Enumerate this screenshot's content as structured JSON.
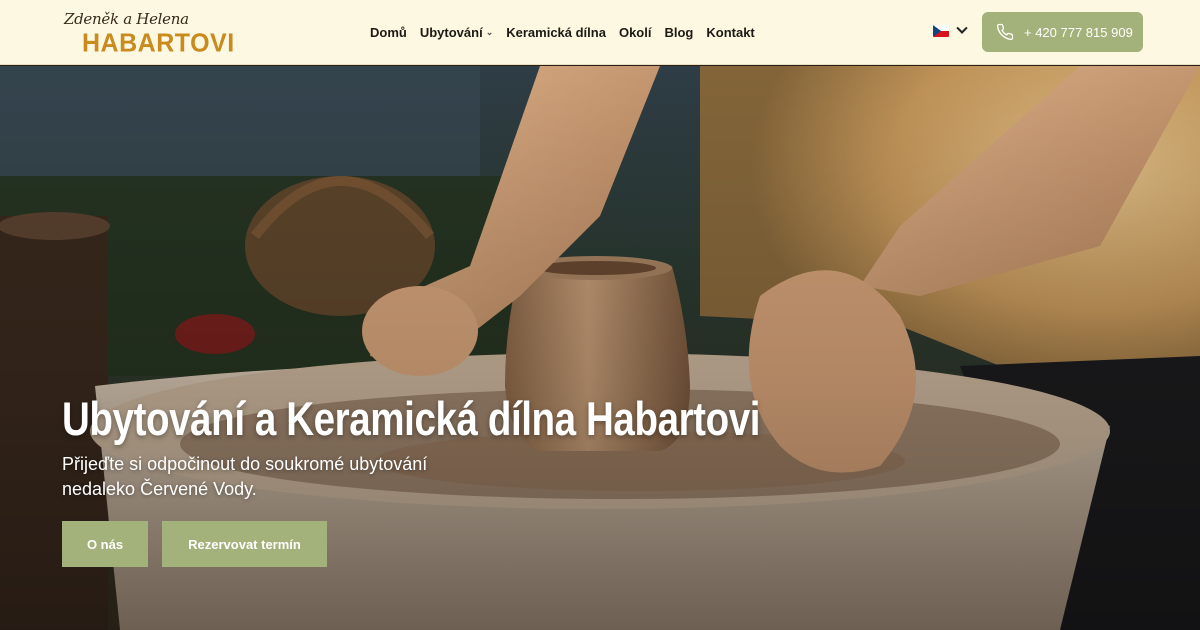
{
  "header": {
    "logo": {
      "script_text": "Zdeněk a Helena",
      "main_text": "HABARTOVI"
    },
    "nav": [
      {
        "label": "Domů"
      },
      {
        "label": "Ubytování",
        "has_dropdown": true
      },
      {
        "label": "Keramická dílna"
      },
      {
        "label": "Okolí"
      },
      {
        "label": "Blog"
      },
      {
        "label": "Kontakt"
      }
    ],
    "language": {
      "flag": "czech-flag-icon"
    },
    "phone": {
      "label": "+ 420 777 815 909",
      "icon": "phone-icon"
    }
  },
  "hero": {
    "title": "Ubytování a Keramická dílna Habartovi",
    "subtitle": "Přijeďte si odpočinout do soukromé ubytování nedaleko Červené Vody.",
    "buttons": [
      {
        "label": "O nás"
      },
      {
        "label": "Rezervovat termín"
      }
    ]
  },
  "colors": {
    "header_bg": "#fdf8e2",
    "accent_green": "#a3b17a",
    "logo_orange": "#c98a1e"
  }
}
